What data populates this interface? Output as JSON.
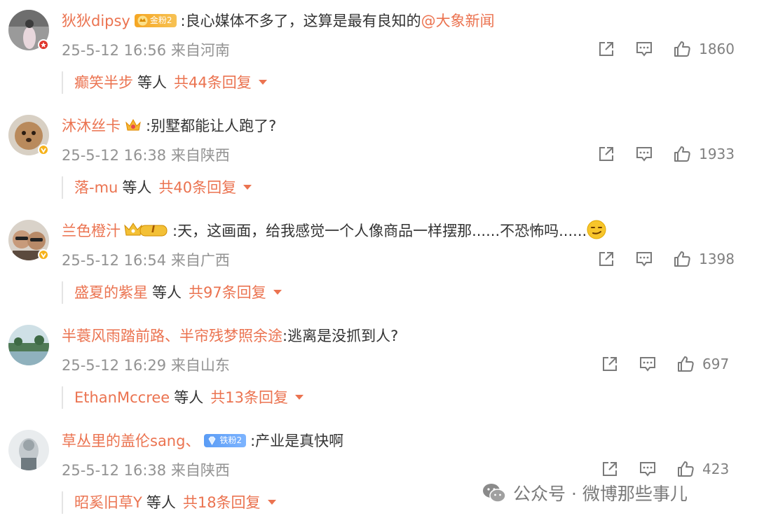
{
  "comments": [
    {
      "username": "狄狄dipsy",
      "badge": {
        "type": "gold",
        "label": "金粉2"
      },
      "text": ":良心媒体不多了，这算是最有良知的",
      "mention": "@大象新闻",
      "time": "25-5-12 16:56",
      "location": "来自河南",
      "likes": "1860",
      "reply_user": "癫笑半步",
      "reply_mid": "等人",
      "reply_total": "共44条回复",
      "avatar_color": "#8a8a8a",
      "verify": "red"
    },
    {
      "username": "沐沐丝卡",
      "badge": {
        "type": "crown"
      },
      "text": ":别墅都能让人跑了?",
      "time": "25-5-12 16:38",
      "location": "来自陕西",
      "likes": "1933",
      "reply_user": "落-mu",
      "reply_mid": "等人",
      "reply_total": "共40条回复",
      "avatar_color": "#b98a5c",
      "verify": "gold"
    },
    {
      "username": "兰色橙汁",
      "badge": {
        "type": "vip",
        "label": "I"
      },
      "text": ":天，这画面，给我感觉一个人像商品一样摆那......不恐怖吗......",
      "emoji": "smirk-emoji",
      "time": "25-5-12 16:54",
      "location": "来自广西",
      "likes": "1398",
      "reply_user": "盛夏的紫星",
      "reply_mid": "等人",
      "reply_total": "共97条回复",
      "avatar_color": "#6b5a4c",
      "verify": "gold"
    },
    {
      "username": "半蓑风雨踏前路、半帘残梦照余途",
      "text": ":逃离是没抓到人?",
      "time": "25-5-12 16:29",
      "location": "来自山东",
      "likes": "697",
      "reply_user": "EthanMccree",
      "reply_mid": "等人",
      "reply_total": "共13条回复",
      "avatar_color": "#5f8a6a",
      "verify": "none"
    },
    {
      "username": "草丛里的盖伦sang、",
      "badge": {
        "type": "iron",
        "label": "铁粉2"
      },
      "text": ":产业是真快啊",
      "time": "25-5-12 16:38",
      "location": "来自陕西",
      "likes": "423",
      "reply_user": "昭奚旧草Y",
      "reply_mid": "等人",
      "reply_total": "共18条回复",
      "avatar_color": "#c9ced2",
      "verify": "none"
    }
  ],
  "icons": {
    "share": "share-icon",
    "comment": "comment-icon",
    "like": "thumbs-up-icon"
  },
  "colors": {
    "username": "#eb7350",
    "meta": "#939393",
    "text": "#333333"
  },
  "watermark": {
    "text": "公众号 · 微博那些事儿",
    "icon": "wechat-icon"
  }
}
